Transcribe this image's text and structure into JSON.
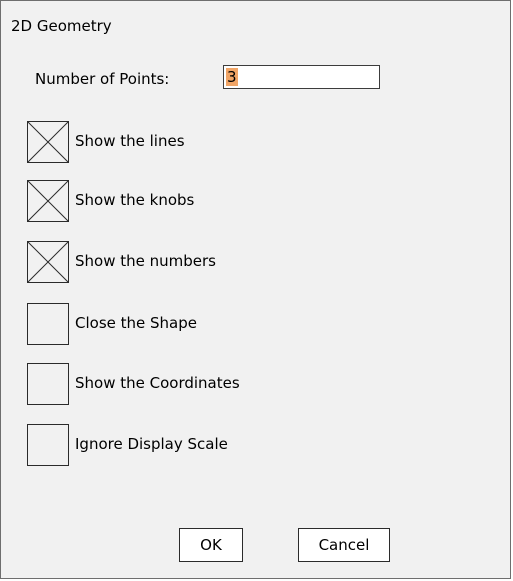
{
  "dialog": {
    "title": "2D Geometry",
    "points": {
      "label": "Number of Points:",
      "value": "3"
    },
    "checkboxes": [
      {
        "label": "Show the lines",
        "checked": true
      },
      {
        "label": "Show the knobs",
        "checked": true
      },
      {
        "label": "Show the numbers",
        "checked": true
      },
      {
        "label": "Close the Shape",
        "checked": false
      },
      {
        "label": "Show the Coordinates",
        "checked": false
      },
      {
        "label": "Ignore Display Scale",
        "checked": false
      }
    ],
    "buttons": {
      "ok_label": "OK",
      "cancel_label": "Cancel"
    }
  }
}
